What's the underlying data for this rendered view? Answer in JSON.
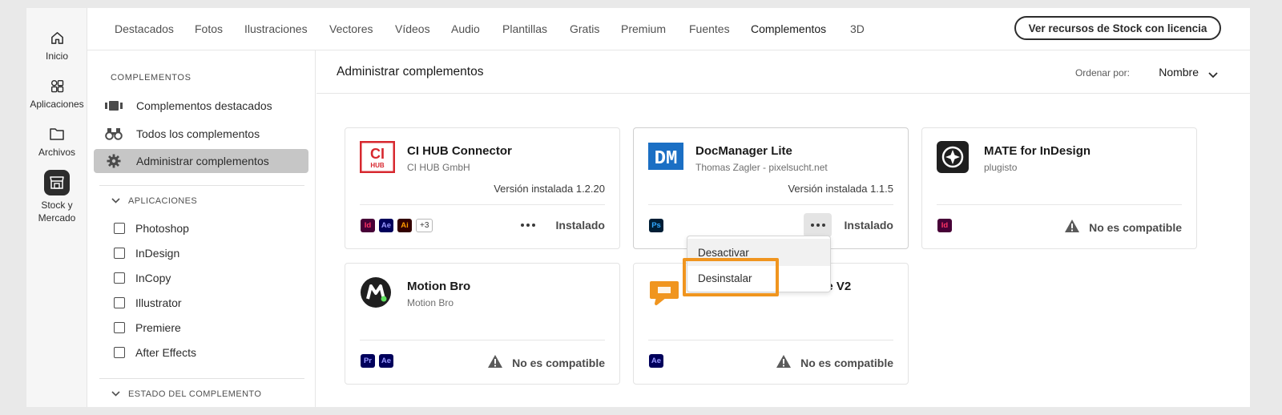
{
  "rail": {
    "items": [
      {
        "label": "Inicio",
        "icon": "home-icon"
      },
      {
        "label": "Aplicaciones",
        "icon": "apps-icon"
      },
      {
        "label": "Archivos",
        "icon": "folder-icon"
      },
      {
        "label": "Stock y Mercado",
        "icon": "stock-market-icon"
      }
    ]
  },
  "topnav": {
    "tabs": [
      "Destacados",
      "Fotos",
      "Ilustraciones",
      "Vectores",
      "Vídeos",
      "Audio",
      "Plantillas",
      "Gratis",
      "Premium",
      "Fuentes",
      "Complementos",
      "3D"
    ],
    "active_tab": "Complementos",
    "stock_button": "Ver recursos de Stock con licencia"
  },
  "side": {
    "heading": "COMPLEMENTOS",
    "items": [
      {
        "label": "Complementos destacados",
        "icon": "featured-icon"
      },
      {
        "label": "Todos los complementos",
        "icon": "binoculars-icon"
      },
      {
        "label": "Administrar complementos",
        "icon": "gear-icon"
      }
    ],
    "apps_group": "APLICACIONES",
    "apps": [
      "Photoshop",
      "InDesign",
      "InCopy",
      "Illustrator",
      "Premiere",
      "After Effects"
    ],
    "status_group": "ESTADO DEL COMPLEMENTO"
  },
  "main": {
    "title": "Administrar complementos",
    "sort_label": "Ordenar por:",
    "sort_value": "Nombre"
  },
  "cards": [
    {
      "name": "CI HUB Connector",
      "author": "CI HUB GmbH",
      "version": "Versión instalada 1.2.20",
      "apps": [
        "Id",
        "Ae",
        "Ai"
      ],
      "more_apps": "+3",
      "status": "Instalado"
    },
    {
      "name": "DocManager Lite",
      "author": "Thomas Zagler - pixelsucht.net",
      "version": "Versión instalada 1.1.5",
      "apps": [
        "Ps"
      ],
      "status": "Instalado"
    },
    {
      "name": "MATE for InDesign",
      "author": "plugisto",
      "apps": [
        "Id"
      ],
      "status": "No es compatible"
    },
    {
      "name": "Motion Bro",
      "author": "Motion Bro",
      "apps": [
        "Pr",
        "Ae"
      ],
      "status": "No es compatible"
    },
    {
      "name": "ee V2",
      "apps": [
        "Ae"
      ],
      "status": "No es compatible"
    }
  ],
  "menu": {
    "items": [
      "Desactivar",
      "Desinstalar"
    ]
  },
  "colors": {
    "highlight": "#f0951f",
    "ci_hub_red": "#d7282f",
    "docmanager_blue": "#1b6fc4",
    "indesign": "#ff3366",
    "aftereffects": "#9999ff",
    "illustrator": "#ff9a00",
    "photoshop": "#31a8ff",
    "premiere": "#9999ff"
  }
}
